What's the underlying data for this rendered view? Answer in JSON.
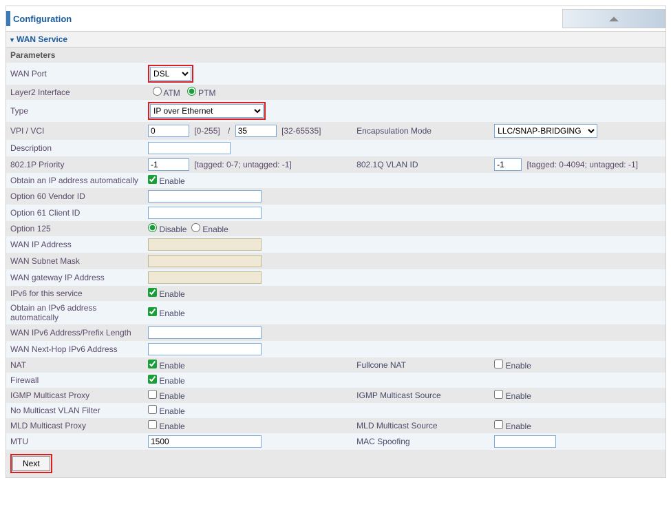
{
  "header": {
    "title": "Configuration"
  },
  "section": {
    "title": "WAN Service",
    "params_label": "Parameters"
  },
  "rows": {
    "wan_port": {
      "label": "WAN Port",
      "value": "DSL"
    },
    "layer2": {
      "label": "Layer2 Interface",
      "atm": "ATM",
      "ptm": "PTM"
    },
    "type": {
      "label": "Type",
      "value": "IP over Ethernet"
    },
    "vpi_vci": {
      "label": "VPI / VCI",
      "vpi": "0",
      "vpi_hint": "[0-255]",
      "sep": "/",
      "vci": "35",
      "vci_hint": "[32-65535]",
      "encap_label": "Encapsulation Mode",
      "encap_value": "LLC/SNAP-BRIDGING"
    },
    "description": {
      "label": "Description",
      "value": ""
    },
    "dot1p": {
      "label": "802.1P Priority",
      "value": "-1",
      "hint": "[tagged: 0-7; untagged: -1]",
      "vlan_label": "802.1Q VLAN ID",
      "vlan_value": "-1",
      "vlan_hint": "[tagged: 0-4094; untagged: -1]"
    },
    "obtain_ip": {
      "label": "Obtain an IP address automatically",
      "enable": "Enable"
    },
    "opt60": {
      "label": "Option 60 Vendor ID",
      "value": ""
    },
    "opt61": {
      "label": "Option 61 Client ID",
      "value": ""
    },
    "opt125": {
      "label": "Option 125",
      "disable": "Disable",
      "enable": "Enable"
    },
    "wan_ip": {
      "label": "WAN IP Address",
      "value": ""
    },
    "wan_mask": {
      "label": "WAN Subnet Mask",
      "value": ""
    },
    "wan_gw": {
      "label": "WAN gateway IP Address",
      "value": ""
    },
    "ipv6_svc": {
      "label": "IPv6 for this service",
      "enable": "Enable"
    },
    "ipv6_auto": {
      "label": "Obtain an IPv6 address automatically",
      "enable": "Enable"
    },
    "ipv6_addr": {
      "label": "WAN IPv6 Address/Prefix Length",
      "value": ""
    },
    "ipv6_nh": {
      "label": "WAN Next-Hop IPv6 Address",
      "value": ""
    },
    "nat": {
      "label": "NAT",
      "enable": "Enable",
      "full_label": "Fullcone NAT",
      "full_enable": "Enable"
    },
    "firewall": {
      "label": "Firewall",
      "enable": "Enable"
    },
    "igmp": {
      "label": "IGMP Multicast Proxy",
      "enable": "Enable",
      "src_label": "IGMP Multicast Source",
      "src_enable": "Enable"
    },
    "novlan": {
      "label": "No Multicast VLAN Filter",
      "enable": "Enable"
    },
    "mld": {
      "label": "MLD Multicast Proxy",
      "enable": "Enable",
      "src_label": "MLD Multicast Source",
      "src_enable": "Enable"
    },
    "mtu": {
      "label": "MTU",
      "value": "1500",
      "mac_label": "MAC Spoofing",
      "mac_value": ""
    }
  },
  "buttons": {
    "next": "Next"
  }
}
